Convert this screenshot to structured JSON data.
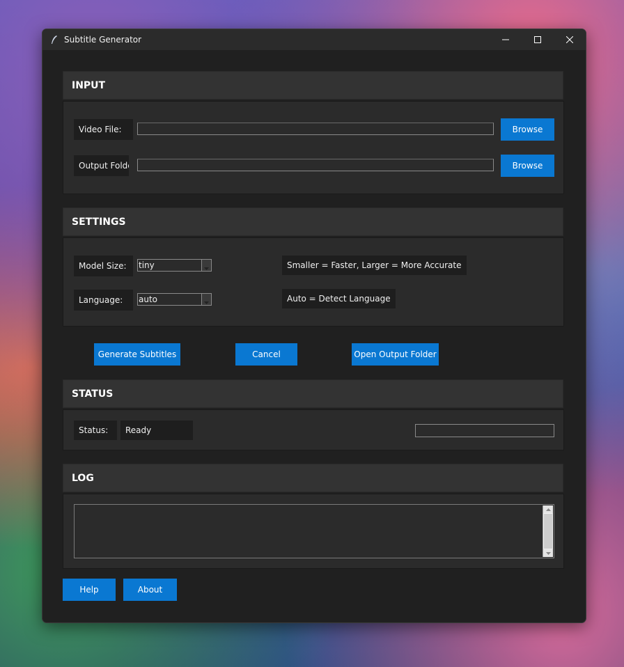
{
  "window": {
    "title": "Subtitle Generator",
    "accent_color": "#0a78d2"
  },
  "input": {
    "header": "INPUT",
    "video_label": "Video File:",
    "video_value": "",
    "output_label": "Output Folder",
    "output_value": "",
    "browse_label": "Browse"
  },
  "settings": {
    "header": "SETTINGS",
    "model_label": "Model Size:",
    "model_value": "tiny",
    "model_hint": "Smaller = Faster, Larger = More Accurate",
    "language_label": "Language:",
    "language_value": "auto",
    "language_hint": "Auto = Detect Language"
  },
  "actions": {
    "generate": "Generate Subtitles",
    "cancel": "Cancel",
    "open_folder": "Open Output Folder"
  },
  "status": {
    "header": "STATUS",
    "label": "Status:",
    "value": "Ready",
    "progress": 0
  },
  "log": {
    "header": "LOG",
    "content": ""
  },
  "footer": {
    "help": "Help",
    "about": "About"
  }
}
